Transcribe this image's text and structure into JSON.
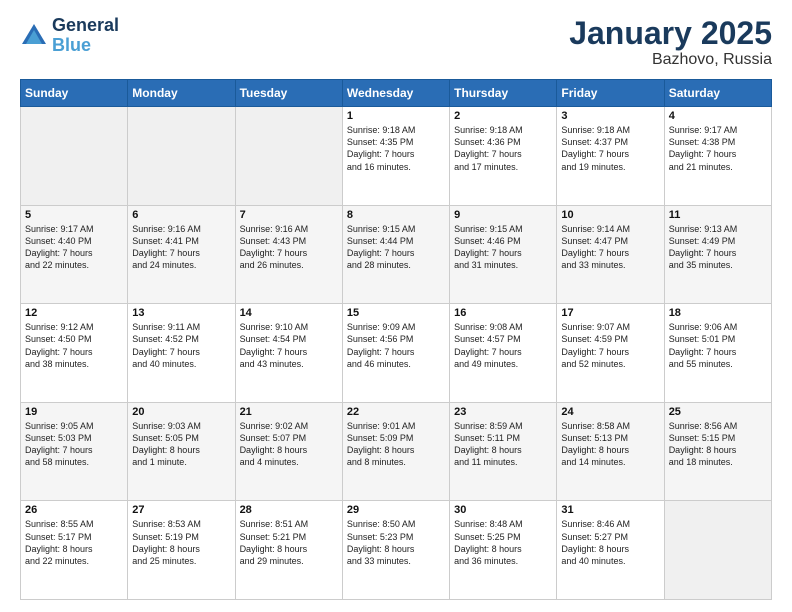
{
  "header": {
    "logo_line1": "General",
    "logo_line2": "Blue",
    "month": "January 2025",
    "location": "Bazhovo, Russia"
  },
  "weekdays": [
    "Sunday",
    "Monday",
    "Tuesday",
    "Wednesday",
    "Thursday",
    "Friday",
    "Saturday"
  ],
  "weeks": [
    [
      {
        "day": "",
        "text": ""
      },
      {
        "day": "",
        "text": ""
      },
      {
        "day": "",
        "text": ""
      },
      {
        "day": "1",
        "text": "Sunrise: 9:18 AM\nSunset: 4:35 PM\nDaylight: 7 hours\nand 16 minutes."
      },
      {
        "day": "2",
        "text": "Sunrise: 9:18 AM\nSunset: 4:36 PM\nDaylight: 7 hours\nand 17 minutes."
      },
      {
        "day": "3",
        "text": "Sunrise: 9:18 AM\nSunset: 4:37 PM\nDaylight: 7 hours\nand 19 minutes."
      },
      {
        "day": "4",
        "text": "Sunrise: 9:17 AM\nSunset: 4:38 PM\nDaylight: 7 hours\nand 21 minutes."
      }
    ],
    [
      {
        "day": "5",
        "text": "Sunrise: 9:17 AM\nSunset: 4:40 PM\nDaylight: 7 hours\nand 22 minutes."
      },
      {
        "day": "6",
        "text": "Sunrise: 9:16 AM\nSunset: 4:41 PM\nDaylight: 7 hours\nand 24 minutes."
      },
      {
        "day": "7",
        "text": "Sunrise: 9:16 AM\nSunset: 4:43 PM\nDaylight: 7 hours\nand 26 minutes."
      },
      {
        "day": "8",
        "text": "Sunrise: 9:15 AM\nSunset: 4:44 PM\nDaylight: 7 hours\nand 28 minutes."
      },
      {
        "day": "9",
        "text": "Sunrise: 9:15 AM\nSunset: 4:46 PM\nDaylight: 7 hours\nand 31 minutes."
      },
      {
        "day": "10",
        "text": "Sunrise: 9:14 AM\nSunset: 4:47 PM\nDaylight: 7 hours\nand 33 minutes."
      },
      {
        "day": "11",
        "text": "Sunrise: 9:13 AM\nSunset: 4:49 PM\nDaylight: 7 hours\nand 35 minutes."
      }
    ],
    [
      {
        "day": "12",
        "text": "Sunrise: 9:12 AM\nSunset: 4:50 PM\nDaylight: 7 hours\nand 38 minutes."
      },
      {
        "day": "13",
        "text": "Sunrise: 9:11 AM\nSunset: 4:52 PM\nDaylight: 7 hours\nand 40 minutes."
      },
      {
        "day": "14",
        "text": "Sunrise: 9:10 AM\nSunset: 4:54 PM\nDaylight: 7 hours\nand 43 minutes."
      },
      {
        "day": "15",
        "text": "Sunrise: 9:09 AM\nSunset: 4:56 PM\nDaylight: 7 hours\nand 46 minutes."
      },
      {
        "day": "16",
        "text": "Sunrise: 9:08 AM\nSunset: 4:57 PM\nDaylight: 7 hours\nand 49 minutes."
      },
      {
        "day": "17",
        "text": "Sunrise: 9:07 AM\nSunset: 4:59 PM\nDaylight: 7 hours\nand 52 minutes."
      },
      {
        "day": "18",
        "text": "Sunrise: 9:06 AM\nSunset: 5:01 PM\nDaylight: 7 hours\nand 55 minutes."
      }
    ],
    [
      {
        "day": "19",
        "text": "Sunrise: 9:05 AM\nSunset: 5:03 PM\nDaylight: 7 hours\nand 58 minutes."
      },
      {
        "day": "20",
        "text": "Sunrise: 9:03 AM\nSunset: 5:05 PM\nDaylight: 8 hours\nand 1 minute."
      },
      {
        "day": "21",
        "text": "Sunrise: 9:02 AM\nSunset: 5:07 PM\nDaylight: 8 hours\nand 4 minutes."
      },
      {
        "day": "22",
        "text": "Sunrise: 9:01 AM\nSunset: 5:09 PM\nDaylight: 8 hours\nand 8 minutes."
      },
      {
        "day": "23",
        "text": "Sunrise: 8:59 AM\nSunset: 5:11 PM\nDaylight: 8 hours\nand 11 minutes."
      },
      {
        "day": "24",
        "text": "Sunrise: 8:58 AM\nSunset: 5:13 PM\nDaylight: 8 hours\nand 14 minutes."
      },
      {
        "day": "25",
        "text": "Sunrise: 8:56 AM\nSunset: 5:15 PM\nDaylight: 8 hours\nand 18 minutes."
      }
    ],
    [
      {
        "day": "26",
        "text": "Sunrise: 8:55 AM\nSunset: 5:17 PM\nDaylight: 8 hours\nand 22 minutes."
      },
      {
        "day": "27",
        "text": "Sunrise: 8:53 AM\nSunset: 5:19 PM\nDaylight: 8 hours\nand 25 minutes."
      },
      {
        "day": "28",
        "text": "Sunrise: 8:51 AM\nSunset: 5:21 PM\nDaylight: 8 hours\nand 29 minutes."
      },
      {
        "day": "29",
        "text": "Sunrise: 8:50 AM\nSunset: 5:23 PM\nDaylight: 8 hours\nand 33 minutes."
      },
      {
        "day": "30",
        "text": "Sunrise: 8:48 AM\nSunset: 5:25 PM\nDaylight: 8 hours\nand 36 minutes."
      },
      {
        "day": "31",
        "text": "Sunrise: 8:46 AM\nSunset: 5:27 PM\nDaylight: 8 hours\nand 40 minutes."
      },
      {
        "day": "",
        "text": ""
      }
    ]
  ]
}
